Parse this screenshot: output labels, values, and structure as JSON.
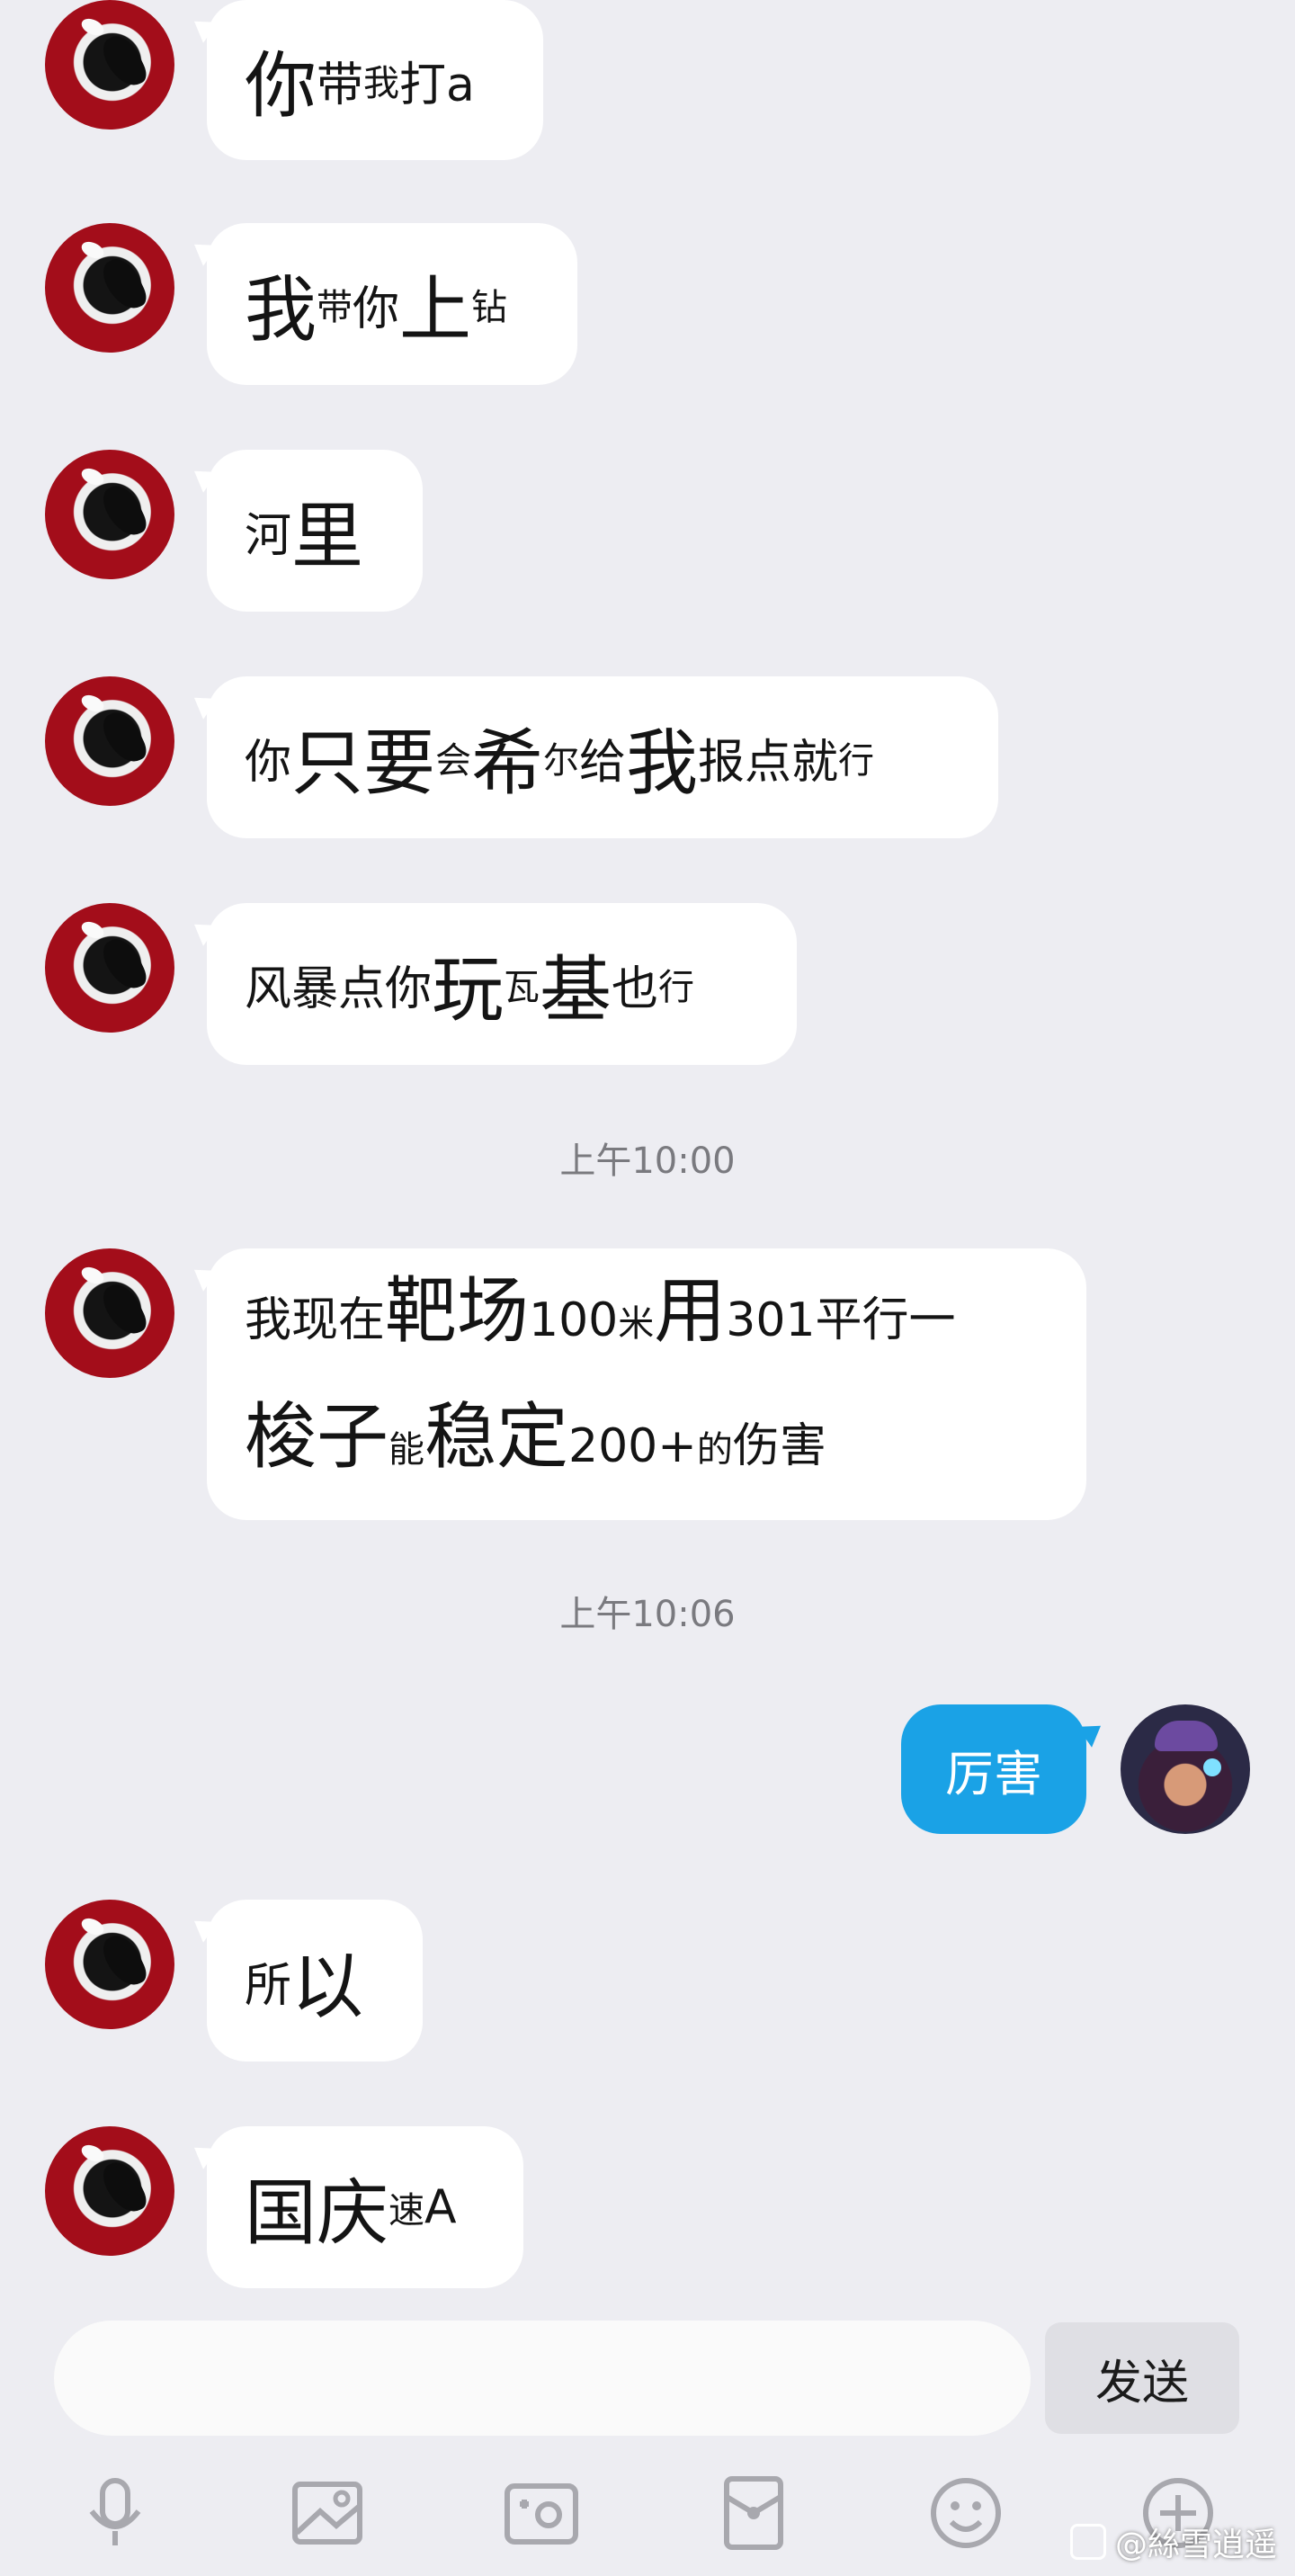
{
  "messages": [
    {
      "segments": [
        [
          "l",
          "你"
        ],
        [
          "m",
          "带"
        ],
        [
          "s",
          "我"
        ],
        [
          "m",
          "打a"
        ]
      ]
    },
    {
      "segments": [
        [
          "l",
          "我"
        ],
        [
          "s",
          "带"
        ],
        [
          "m",
          "你"
        ],
        [
          "l",
          "上"
        ],
        [
          "s",
          "钻"
        ]
      ]
    },
    {
      "segments": [
        [
          "m",
          "河"
        ],
        [
          "l",
          "里"
        ]
      ]
    },
    {
      "segments": [
        [
          "m",
          "你"
        ],
        [
          "l",
          "只要"
        ],
        [
          "s",
          "会"
        ],
        [
          "l",
          "希"
        ],
        [
          "s",
          "尔"
        ],
        [
          "m",
          "给"
        ],
        [
          "l",
          "我"
        ],
        [
          "m",
          "报点就"
        ],
        [
          "s",
          "行"
        ]
      ]
    },
    {
      "segments": [
        [
          "m",
          "风暴点你"
        ],
        [
          "l",
          "玩"
        ],
        [
          "s",
          "瓦"
        ],
        [
          "l",
          "基"
        ],
        [
          "m",
          "也"
        ],
        [
          "s",
          "行"
        ]
      ]
    },
    {
      "lines": [
        [
          [
            "m",
            "我现在"
          ],
          [
            "l",
            "靶场"
          ],
          [
            "m",
            "100"
          ],
          [
            "s",
            "米"
          ],
          [
            "l",
            "用"
          ],
          [
            "m",
            "301平行一"
          ]
        ],
        [
          [
            "l",
            "梭子"
          ],
          [
            "s",
            "能"
          ],
          [
            "l",
            "稳定"
          ],
          [
            "m",
            "200+"
          ],
          [
            "s",
            "的"
          ],
          [
            "m",
            "伤害"
          ]
        ]
      ]
    },
    {
      "segments": [
        [
          "m",
          "所"
        ],
        [
          "l",
          "以"
        ]
      ]
    },
    {
      "segments": [
        [
          "l",
          "国庆"
        ],
        [
          "s",
          "速"
        ],
        [
          "m",
          "A"
        ]
      ]
    }
  ],
  "timestamps": [
    "上午10:00",
    "上午10:06"
  ],
  "my_message": "厉害",
  "input": {
    "placeholder": "",
    "send_label": "发送"
  },
  "toolbar": [
    "mic-icon",
    "image-icon",
    "camera-icon",
    "red-packet-icon",
    "emoji-icon",
    "plus-icon"
  ],
  "watermark": "@絲雪逍遥",
  "colors": {
    "background": "#ededf2",
    "my_bubble": "#1aa2e6",
    "their_bubble": "#ffffff",
    "send_button": "#dfdfe4"
  }
}
